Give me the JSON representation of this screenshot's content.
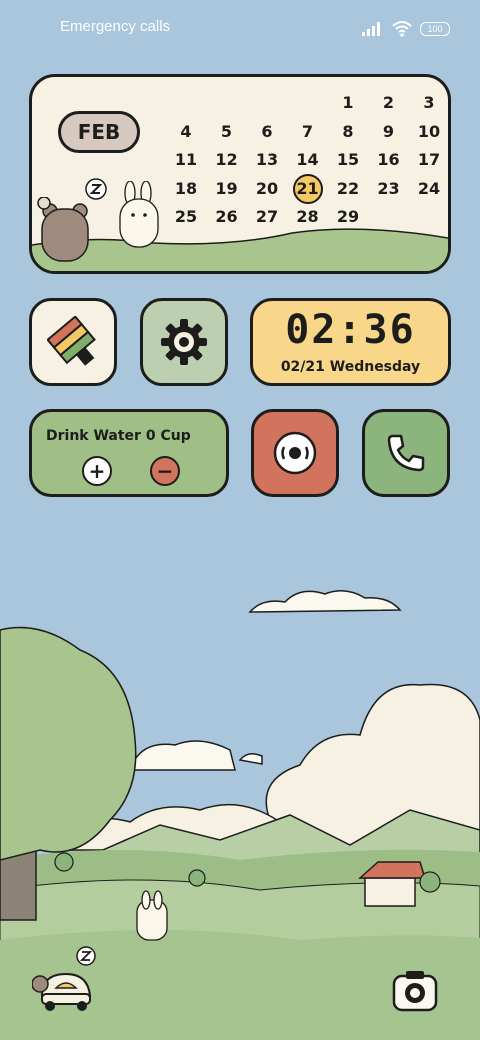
{
  "status_bar": {
    "carrier_text": "Emergency calls",
    "battery": "100"
  },
  "calendar": {
    "month": "FEB",
    "today": "21",
    "weeks": [
      [
        "",
        "",
        "",
        "",
        "1",
        "2",
        "3"
      ],
      [
        "4",
        "5",
        "6",
        "7",
        "8",
        "9",
        "10"
      ],
      [
        "11",
        "12",
        "13",
        "14",
        "15",
        "16",
        "17"
      ],
      [
        "18",
        "19",
        "20",
        "21",
        "22",
        "23",
        "24"
      ],
      [
        "25",
        "26",
        "27",
        "28",
        "29",
        "",
        ""
      ]
    ]
  },
  "clock": {
    "time": "02:36",
    "date": "02/21 Wednesday"
  },
  "water": {
    "label": "Drink Water 0 Cup",
    "plus": "+",
    "minus": "−"
  },
  "icons": {
    "paint": "paint-palette-icon",
    "settings": "gear-icon",
    "recorder": "record-icon",
    "phone": "phone-icon",
    "car": "car-icon",
    "camera": "camera-icon"
  },
  "colors": {
    "sky": "#a9c6dc",
    "calendar_bg": "#f6f1e3",
    "clock_bg": "#f8d78a",
    "green": "#9fbf87",
    "red": "#d2735e",
    "gear_bg": "#bccfb0",
    "today_highlight": "#f4c964"
  }
}
